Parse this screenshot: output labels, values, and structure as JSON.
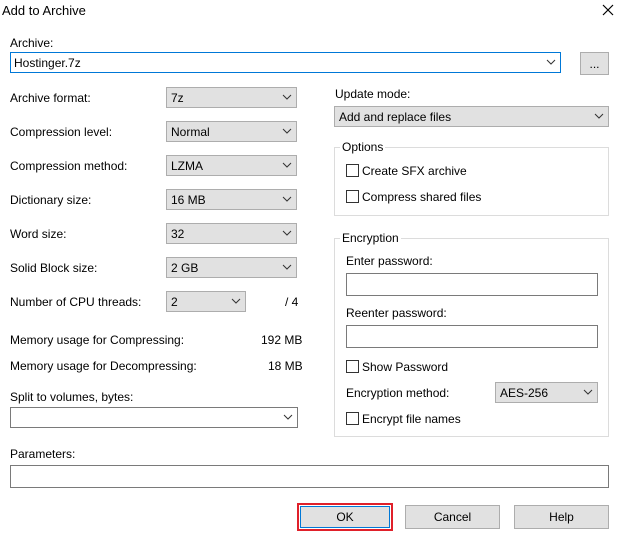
{
  "window": {
    "title": "Add to Archive",
    "close_icon": "close-icon"
  },
  "archive": {
    "label": "Archive:",
    "value": "Hostinger.7z",
    "browse_label": "..."
  },
  "left": {
    "format": {
      "label": "Archive format:",
      "value": "7z"
    },
    "level": {
      "label": "Compression level:",
      "value": "Normal"
    },
    "method": {
      "label": "Compression method:",
      "value": "LZMA"
    },
    "dictionary": {
      "label": "Dictionary size:",
      "value": "16 MB"
    },
    "word": {
      "label": "Word size:",
      "value": "32"
    },
    "solid": {
      "label": "Solid Block size:",
      "value": "2 GB"
    },
    "threads": {
      "label": "Number of CPU threads:",
      "value": "2",
      "total": "/ 4"
    },
    "mem_compress": {
      "label": "Memory usage for Compressing:",
      "value": "192 MB"
    },
    "mem_decompress": {
      "label": "Memory usage for Decompressing:",
      "value": "18 MB"
    },
    "split": {
      "label": "Split to volumes, bytes:",
      "value": ""
    }
  },
  "right": {
    "update": {
      "label": "Update mode:",
      "value": "Add and replace files"
    },
    "options": {
      "title": "Options",
      "sfx": {
        "label": "Create SFX archive",
        "checked": false
      },
      "shared": {
        "label": "Compress shared files",
        "checked": false
      }
    },
    "encryption": {
      "title": "Encryption",
      "enter_label": "Enter password:",
      "reenter_label": "Reenter password:",
      "show": {
        "label": "Show Password",
        "checked": false
      },
      "method_label": "Encryption method:",
      "method_value": "AES-256",
      "names": {
        "label": "Encrypt file names",
        "checked": false
      }
    }
  },
  "parameters": {
    "label": "Parameters:",
    "value": ""
  },
  "buttons": {
    "ok": "OK",
    "cancel": "Cancel",
    "help": "Help"
  },
  "colors": {
    "highlight": "#e0202a",
    "focus": "#0078d7",
    "button_bg": "#e1e1e1"
  }
}
